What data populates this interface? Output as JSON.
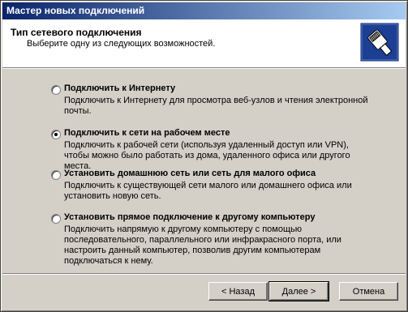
{
  "window": {
    "title": "Мастер новых подключений"
  },
  "header": {
    "title": "Тип сетевого подключения",
    "subtitle": "Выберите одну из следующих возможностей."
  },
  "options": [
    {
      "label": "Подключить к Интернету",
      "description": "Подключить к Интернету для просмотра веб-узлов и чтения  электронной почты.",
      "selected": false
    },
    {
      "label": "Подключить к сети на рабочем месте",
      "description": "Подключить к рабочей сети (используя удаленный доступ или VPN), чтобы можно было работать из дома, удаленного офиса или другого места.",
      "selected": true
    },
    {
      "label": "Установить домашнюю сеть или сеть для малого офиса",
      "description": "Подключить к существующей сети малого или домашнего офиса или установить новую сеть.",
      "selected": false
    },
    {
      "label": "Установить прямое подключение к другому компьютеру",
      "description": "Подключить напрямую к другому компьютеру с помощью последовательного, параллельного или инфракрасного порта, или настроить данный компьютер, позволив другим  компьютерам подключаться к нему.",
      "selected": false
    }
  ],
  "buttons": {
    "back": "< Назад",
    "next": "Далее >",
    "cancel": "Отмена"
  }
}
